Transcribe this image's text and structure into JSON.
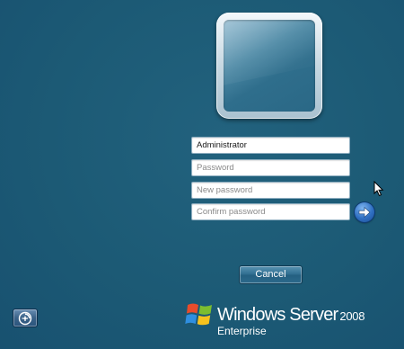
{
  "logon": {
    "username_value": "Administrator",
    "password_placeholder": "Password",
    "new_password_placeholder": "New password",
    "confirm_password_placeholder": "Confirm password",
    "submit_icon": "arrow-right-icon",
    "cancel_label": "Cancel"
  },
  "ease_of_access": {
    "icon": "ease-of-access-icon"
  },
  "branding": {
    "product_name": "Windows Server",
    "version": "2008",
    "edition": "Enterprise",
    "logo_icon": "windows-flag-icon"
  },
  "colors": {
    "background": "#1d5b76",
    "field_background": "#ffffff",
    "accent_blue": "#2f6fc2"
  }
}
